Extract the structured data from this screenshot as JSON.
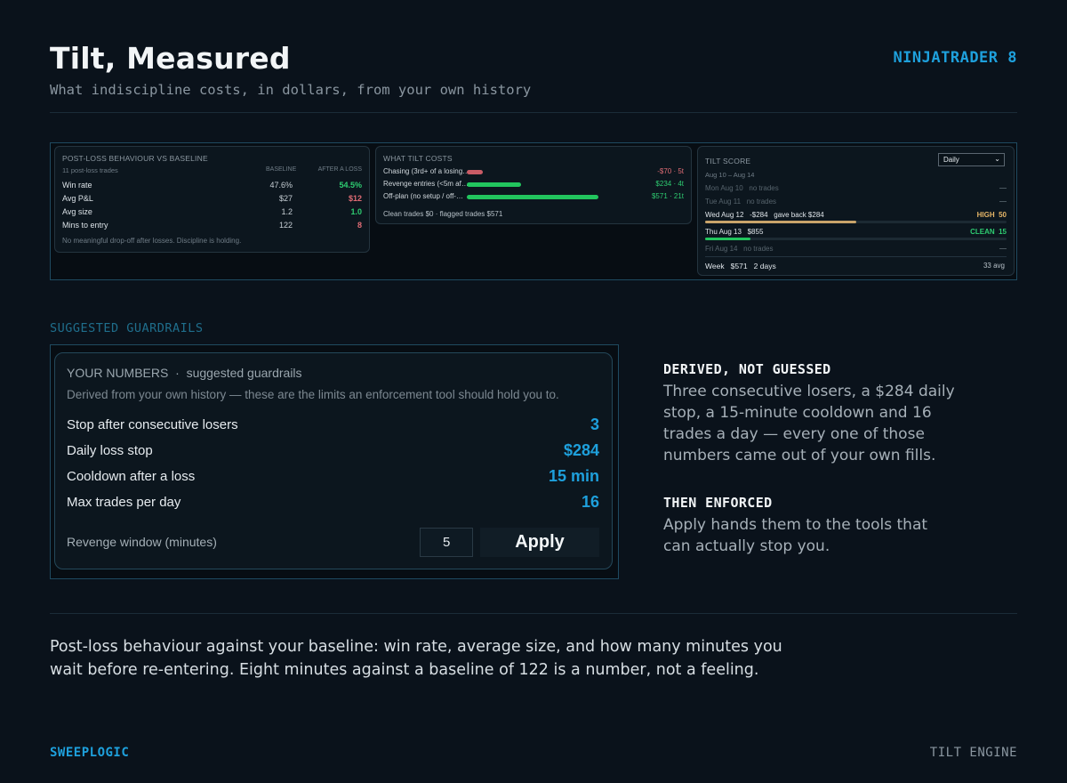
{
  "header": {
    "title": "Tilt, Measured",
    "subtitle": "What indiscipline costs, in dollars, from your own history",
    "platform": "NINJATRADER 8"
  },
  "post_loss": {
    "title": "POST-LOSS BEHAVIOUR vs BASELINE",
    "sample": "11 post-loss trades",
    "col_baseline": "BASELINE",
    "col_after": "AFTER A LOSS",
    "rows": [
      {
        "label": "Win rate",
        "baseline": "47.6%",
        "after": "54.5%",
        "after_color": "#2ecc71"
      },
      {
        "label": "Avg P&L",
        "baseline": "$27",
        "after": "$12",
        "after_color": "#e06c75"
      },
      {
        "label": "Avg size",
        "baseline": "1.2",
        "after": "1.0",
        "after_color": "#2ecc71"
      },
      {
        "label": "Mins to entry",
        "baseline": "122",
        "after": "8",
        "after_color": "#e06c75"
      }
    ],
    "note": "No meaningful drop-off after losses. Discipline is holding."
  },
  "tilt_costs": {
    "title": "WHAT TILT COSTS",
    "rows": [
      {
        "label": "Chasing (3rd+ of a losing…",
        "value": "-$70 · 5t",
        "value_color": "#e06c75",
        "bar_color": "#c95c66",
        "fill": 0.12
      },
      {
        "label": "Revenge entries (<5m af…",
        "value": "$234 · 4t",
        "value_color": "#2ecc71",
        "bar_color": "#22c55e",
        "fill": 0.41
      },
      {
        "label": "Off-plan (no setup / off-…",
        "value": "$571 · 21t",
        "value_color": "#2ecc71",
        "bar_color": "#22c55e",
        "fill": 1.0
      }
    ],
    "footer": "Clean trades $0  ·  flagged trades $571"
  },
  "tilt_score": {
    "title": "TILT SCORE",
    "period": "Daily",
    "range": "Aug 10 – Aug 14",
    "days": [
      {
        "label": "Mon Aug 10   no trades",
        "status": "—",
        "dim": true
      },
      {
        "label": "Tue Aug 11   no trades",
        "status": "—",
        "dim": true
      },
      {
        "label": "Wed Aug 12   -$284   gave back $284",
        "status": "HIGH  50",
        "status_color": "#e5b567",
        "bar_color": "#c9a46a",
        "fill": 0.5,
        "dim": false
      },
      {
        "label": "Thu Aug 13   $855",
        "status": "CLEAN  15",
        "status_color": "#2ecc71",
        "bar_color": "#22c55e",
        "fill": 0.15,
        "dim": false
      },
      {
        "label": "Fri Aug 14   no trades",
        "status": "—",
        "dim": true
      }
    ],
    "week_label": "Week   $571   2 days",
    "week_avg": "33 avg"
  },
  "guardrails": {
    "section_label": "SUGGESTED GUARDRAILS",
    "heading": "YOUR NUMBERS  ·  suggested guardrails",
    "subheading": "Derived from your own history — these are the limits an enforcement tool should hold you to.",
    "rows": [
      {
        "label": "Stop after consecutive losers",
        "value": "3"
      },
      {
        "label": "Daily loss stop",
        "value": "$284"
      },
      {
        "label": "Cooldown after a loss",
        "value": "15 min"
      },
      {
        "label": "Max trades per day",
        "value": "16"
      }
    ],
    "revenge_label": "Revenge window (minutes)",
    "revenge_value": "5",
    "apply_label": "Apply"
  },
  "copy": {
    "h1": "DERIVED, NOT GUESSED",
    "p1": "Three consecutive losers, a $284 daily stop, a 15-minute cooldown and 16 trades a day — every one of those numbers came out of your own fills.",
    "h2": "THEN ENFORCED",
    "p2": "Apply hands them to the tools that can actually stop you."
  },
  "caption": "Post-loss behaviour against your baseline: win rate, average size, and how many minutes you wait before re-entering. Eight minutes against a baseline of 122 is a number, not a feeling.",
  "footer": {
    "brand": "SWEEPLOGIC",
    "product": "TILT ENGINE"
  }
}
